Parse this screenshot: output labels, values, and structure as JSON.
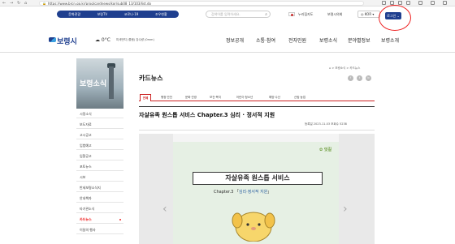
{
  "browser": {
    "url": "https://www.brcn.go.kr/prog/cardnews/kor/sub08_13/103/list.do"
  },
  "utility": {
    "quicklinks": [
      "문화관광",
      "보령TV",
      "코로나-19",
      "조우현황"
    ],
    "search_placeholder": "검색어를 입력하세요.",
    "links": [
      "누리집지도",
      "보령시의회"
    ],
    "language": "KOR",
    "login_label": "로그인"
  },
  "header": {
    "logo": "보령시",
    "weather_temp": "0°C",
    "weather_detail": "미세먼지 (좋음)  강수량 (0mm)",
    "gnb": [
      "정보공개",
      "소통·참여",
      "전자민원",
      "보령소식",
      "분야별정보",
      "보령소개"
    ]
  },
  "sidebar": {
    "title": "보령소식",
    "items": [
      "시정소식",
      "보도자료",
      "고시공고",
      "입법예고",
      "입찰공고",
      "포토뉴스",
      "시보",
      "반세보령소식지",
      "안내책자",
      "타기관소식",
      "카드뉴스",
      "이달의 행사"
    ],
    "active_index": 10
  },
  "content": {
    "page_title": "카드뉴스",
    "breadcrumb": "⌂ > 보령소식 > 카드뉴스",
    "share_icons": [
      "f",
      "t",
      "b",
      "✉"
    ],
    "tabs": [
      "전체",
      "행정·안전",
      "문화·관광",
      "보건·복지",
      "어린이·청소년",
      "해양·수산",
      "산림·농업"
    ],
    "active_tab": 0,
    "post_title": "자살유족 원스톱 서비스 Chapter.3 심리 · 정서적 지원",
    "post_meta": "등록일  2023-11-03    조회수  5238"
  },
  "card": {
    "brand": "✿ 잇길",
    "title": "자살유족 원스톱 서비스",
    "subtitle_prefix": "Chapter.3 「",
    "subtitle_highlight": "심리·정서적 지원",
    "subtitle_suffix": "」",
    "arrow_prev": "‹",
    "arrow_next": "›"
  },
  "colors": {
    "brand_navy": "#1f3f8f",
    "accent_red": "#cc2222",
    "card_bg": "#e6f0e4"
  }
}
